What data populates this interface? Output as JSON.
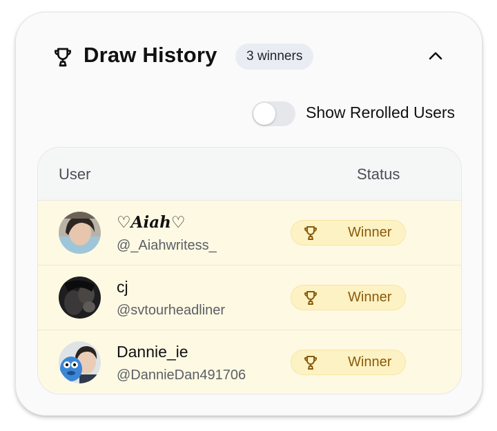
{
  "header": {
    "title": "Draw History",
    "title_icon": "trophy-icon",
    "badge": "3 winners",
    "collapse_icon": "chevron-up-icon"
  },
  "toggle": {
    "label": "Show Rerolled Users",
    "on": false
  },
  "table": {
    "columns": [
      "User",
      "Status"
    ],
    "rows": [
      {
        "name": "♡𝑨𝒊𝒂𝒉♡",
        "handle": "@_Aiahwritess_",
        "status": "Winner",
        "status_icon": "trophy-icon"
      },
      {
        "name": "cj",
        "handle": "@svtourheadliner",
        "status": "Winner",
        "status_icon": "trophy-icon"
      },
      {
        "name": "Dannie_ie",
        "handle": "@DannieDan491706",
        "status": "Winner",
        "status_icon": "trophy-icon"
      }
    ]
  },
  "colors": {
    "winner_text": "#8a5a0a",
    "winner_bg": "#fdf2c4",
    "row_bg": "#fef9e3",
    "badge_bg": "#e9edf3"
  }
}
